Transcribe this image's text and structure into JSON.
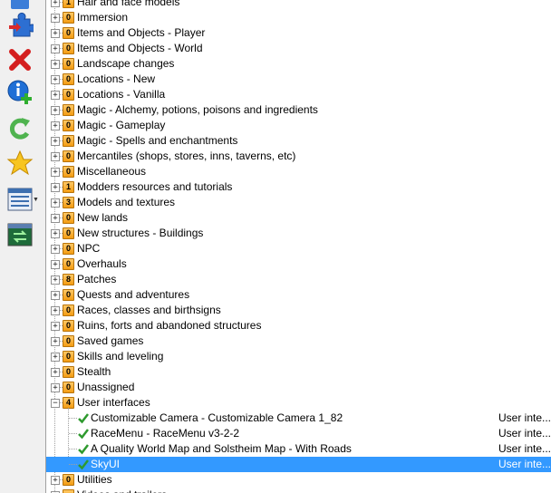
{
  "toolbar": {
    "buttons": [
      {
        "icon": "install-mod-icon"
      },
      {
        "icon": "puzzle-icon"
      },
      {
        "icon": "delete-icon"
      },
      {
        "icon": "info-add-icon"
      },
      {
        "icon": "refresh-icon"
      },
      {
        "icon": "star-icon"
      },
      {
        "icon": "list-view-icon"
      },
      {
        "icon": "transfer-icon"
      }
    ]
  },
  "tree": {
    "categories": [
      {
        "label": "Hair and face models",
        "count": "1",
        "expanded": false
      },
      {
        "label": "Immersion",
        "count": "0",
        "expanded": false
      },
      {
        "label": "Items and Objects - Player",
        "count": "0",
        "expanded": false
      },
      {
        "label": "Items and Objects - World",
        "count": "0",
        "expanded": false
      },
      {
        "label": "Landscape changes",
        "count": "0",
        "expanded": false
      },
      {
        "label": "Locations - New",
        "count": "0",
        "expanded": false
      },
      {
        "label": "Locations - Vanilla",
        "count": "0",
        "expanded": false
      },
      {
        "label": "Magic - Alchemy, potions, poisons and ingredients",
        "count": "0",
        "expanded": false
      },
      {
        "label": "Magic - Gameplay",
        "count": "0",
        "expanded": false
      },
      {
        "label": "Magic - Spells and enchantments",
        "count": "0",
        "expanded": false
      },
      {
        "label": "Mercantiles (shops, stores, inns, taverns, etc)",
        "count": "0",
        "expanded": false
      },
      {
        "label": "Miscellaneous",
        "count": "0",
        "expanded": false
      },
      {
        "label": "Modders resources and tutorials",
        "count": "1",
        "expanded": false
      },
      {
        "label": "Models and textures",
        "count": "3",
        "expanded": false
      },
      {
        "label": "New lands",
        "count": "0",
        "expanded": false
      },
      {
        "label": "New structures - Buildings",
        "count": "0",
        "expanded": false
      },
      {
        "label": "NPC",
        "count": "0",
        "expanded": false
      },
      {
        "label": "Overhauls",
        "count": "0",
        "expanded": false
      },
      {
        "label": "Patches",
        "count": "8",
        "expanded": false
      },
      {
        "label": "Quests and adventures",
        "count": "0",
        "expanded": false
      },
      {
        "label": "Races, classes and birthsigns",
        "count": "0",
        "expanded": false
      },
      {
        "label": "Ruins, forts and abandoned structures",
        "count": "0",
        "expanded": false
      },
      {
        "label": "Saved games",
        "count": "0",
        "expanded": false
      },
      {
        "label": "Skills and leveling",
        "count": "0",
        "expanded": false
      },
      {
        "label": "Stealth",
        "count": "0",
        "expanded": false
      },
      {
        "label": "Unassigned",
        "count": "0",
        "expanded": false
      },
      {
        "label": "User interfaces",
        "count": "4",
        "expanded": true,
        "children": [
          {
            "label": "Customizable Camera - Customizable Camera 1_82",
            "category": "User inte...",
            "selected": false
          },
          {
            "label": "RaceMenu - RaceMenu v3-2-2",
            "category": "User inte...",
            "selected": false
          },
          {
            "label": "A Quality World Map and Solstheim Map - With Roads",
            "category": "User inte...",
            "selected": false
          },
          {
            "label": "SkyUI",
            "category": "User inte...",
            "selected": true
          }
        ]
      },
      {
        "label": "Utilities",
        "count": "0",
        "expanded": false
      },
      {
        "label": "Videos and trailers",
        "count": "",
        "expanded": false
      }
    ]
  },
  "colors": {
    "selection": "#3399ff",
    "badge": "#f39c12",
    "check": "#2e9a2e"
  }
}
